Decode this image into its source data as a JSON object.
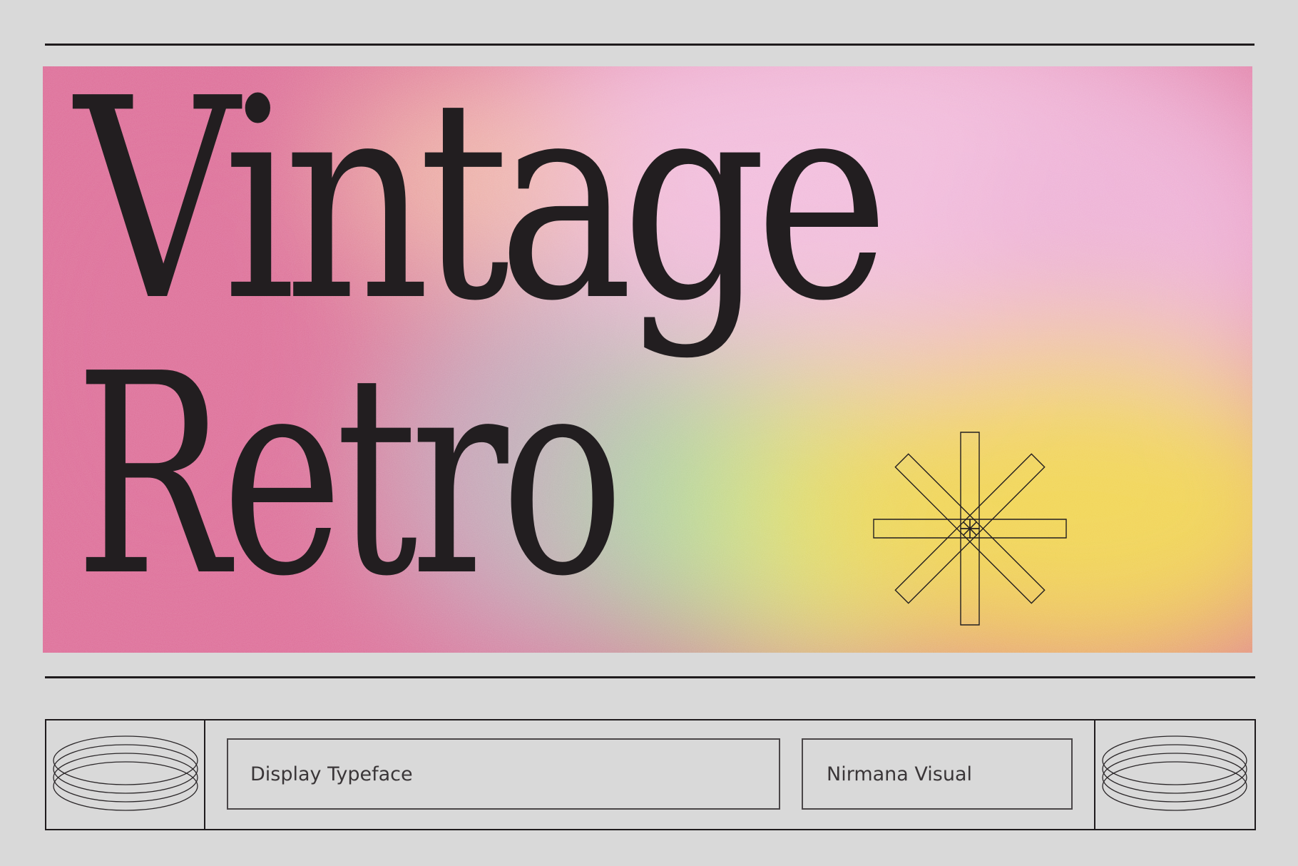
{
  "banner": {
    "headline_line_1": "Vintage",
    "headline_line_2": "Retro",
    "ornament_icon": "eight-point-asterisk-icon",
    "gradient_colors": {
      "pink": "#dd6f97",
      "light_pink": "#f2bcdc",
      "peach": "#f0b8a7",
      "grey_violet": "#c4a9ba",
      "mint": "#a9d3a3",
      "lime": "#d6e077",
      "yellow": "#f1d458"
    }
  },
  "footer": {
    "left_ornament_icon": "concentric-rings-icon",
    "right_ornament_icon": "concentric-rings-icon",
    "typeface_label": "Display Typeface",
    "studio_label": "Nirmana Visual"
  },
  "colors": {
    "background": "#d9d9d9",
    "ink": "#221e20",
    "label_text": "#3a3638"
  }
}
